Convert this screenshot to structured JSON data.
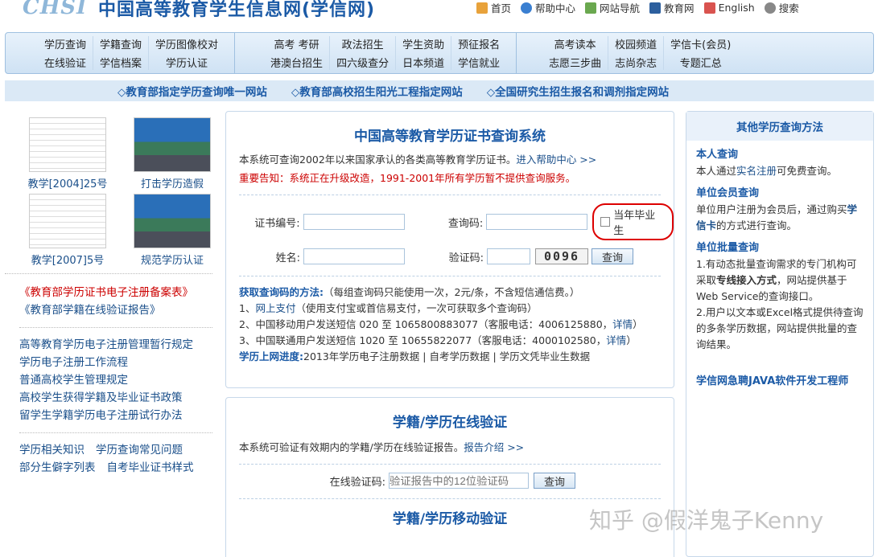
{
  "header": {
    "logo_text": "CHSI",
    "title": "中国高等教育学生信息网(学信网)",
    "toplinks": [
      "首页",
      "帮助中心",
      "网站导航",
      "教育网",
      "English",
      "搜索"
    ]
  },
  "nav": {
    "groups": [
      [
        [
          "学历查询",
          "在线验证"
        ],
        [
          "学籍查询",
          "学信档案"
        ],
        [
          "学历图像校对",
          "学历认证"
        ]
      ],
      [
        [
          "高考 考研",
          "港澳台招生"
        ],
        [
          "政法招生",
          "四六级查分"
        ],
        [
          "学生资助",
          "日本频道"
        ],
        [
          "预征报名",
          "学信就业"
        ]
      ],
      [
        [
          "高考读本",
          "志愿三步曲"
        ],
        [
          "校园频道",
          "志尚杂志"
        ],
        [
          "学信卡(会员)",
          "专题汇总"
        ]
      ]
    ]
  },
  "subbar": [
    "◇教育部指定学历查询唯一网站",
    "◇教育部高校招生阳光工程指定网站",
    "◇全国研究生招生报名和调剂指定网站"
  ],
  "left": {
    "thumbs": [
      "教学[2004]25号",
      "打击学历造假",
      "教学[2007]5号",
      "规范学历认证"
    ],
    "links1": [
      "《教育部学历证书电子注册备案表》",
      "《教育部学籍在线验证报告》"
    ],
    "links2": [
      "高等教育学历电子注册管理暂行规定",
      "学历电子注册工作流程",
      "普通高校学生管理规定",
      "高校学生获得学籍及毕业证书政策",
      "留学生学籍学历电子注册试行办法"
    ],
    "links3": [
      [
        "学历相关知识",
        "学历查询常见问题"
      ],
      [
        "部分生僻字列表",
        "自考毕业证书样式"
      ]
    ]
  },
  "main": {
    "title": "中国高等教育学历证书查询系统",
    "desc": "本系统可查询2002年以来国家承认的各类高等教育学历证书。",
    "help_link": "进入帮助中心 >>",
    "warning": "重要告知：系统正在升级改造，1991-2001年所有学历暂不提供查询服务。",
    "cert_label": "证书编号:",
    "query_code_label": "查询码:",
    "grad_label": "当年毕业生",
    "name_label": "姓名:",
    "verify_label": "验证码:",
    "captcha": "0096",
    "query_btn": "查询",
    "info_title": "获取查询码的方法:",
    "info_title_rest": "（每组查询码只能使用一次，2元/条，不含短信通信费。）",
    "info1_pre": "1、",
    "info1_link": "网上支付",
    "info1_rest": "（使用支付宝或首信易支付，一次可获取多个查询码）",
    "info2": "2、中国移动用户发送短信 020 至 1065800883077（客服电话：4006125880，",
    "info3": "3、中国联通用户发送短信 1020 至 10655822077（客服电话：4000102580，",
    "detail_link": "详情",
    "info_close": "）",
    "progress_label": "学历上网进度:",
    "progress_text": "2013年学历电子注册数据 | 自考学历数据 | 学历文凭毕业生数据"
  },
  "main2": {
    "title": "学籍/学历在线验证",
    "desc": "本系统可验证有效期内的学籍/学历在线验证报告。",
    "report_link": "报告介绍 >>",
    "code_label": "在线验证码:",
    "code_placeholder": "验证报告中的12位验证码",
    "query_btn": "查询",
    "title2": "学籍/学历移动验证"
  },
  "right": {
    "title": "其他学历查询方法",
    "s1_title": "本人查询",
    "s1_pre": "本人通过",
    "s1_link": "实名注册",
    "s1_post": "可免费查询。",
    "s2_title": "单位会员查询",
    "s2_pre": "单位用户注册为会员后，通过购买",
    "s2_link": "学信卡",
    "s2_post": "的方式进行查询。",
    "s3_title": "单位批量查询",
    "s3_p1_pre": "1.有动态批量查询需求的专门机构可采取",
    "s3_p1_bold": "专线接入方式",
    "s3_p1_post": "，网站提供基于Web Service的查询接口。",
    "s3_p2": "2.用户以文本或Excel格式提供待查询的多条学历数据，网站提供批量的查询结果。",
    "job": "学信网急聘JAVA软件开发工程师"
  },
  "watermark": "知乎 @假洋鬼子Kenny"
}
